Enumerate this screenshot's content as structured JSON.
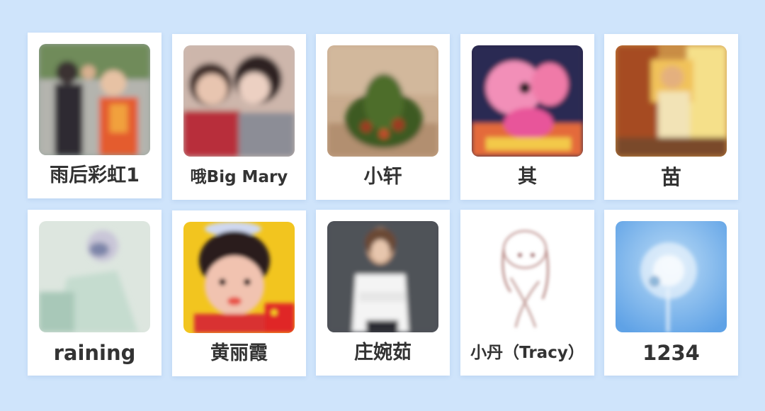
{
  "contacts": [
    {
      "name": "雨后彩虹1",
      "avatar_icon": "avatar-photo-icon"
    },
    {
      "name": "哦Big Mary",
      "avatar_icon": "avatar-photo-icon"
    },
    {
      "name": "小轩",
      "avatar_icon": "avatar-photo-icon"
    },
    {
      "name": "其",
      "avatar_icon": "avatar-photo-icon"
    },
    {
      "name": "苗",
      "avatar_icon": "avatar-photo-icon"
    },
    {
      "name": "raining",
      "avatar_icon": "avatar-photo-icon"
    },
    {
      "name": "黄丽霞",
      "avatar_icon": "avatar-photo-icon"
    },
    {
      "name": "庄婉茹",
      "avatar_icon": "avatar-photo-icon"
    },
    {
      "name": "小丹（Tracy）",
      "avatar_icon": "avatar-photo-icon"
    },
    {
      "name": "1234",
      "avatar_icon": "avatar-photo-icon"
    }
  ],
  "colors": {
    "background": "#cfe4fb",
    "card": "#ffffff",
    "text": "#333333"
  }
}
